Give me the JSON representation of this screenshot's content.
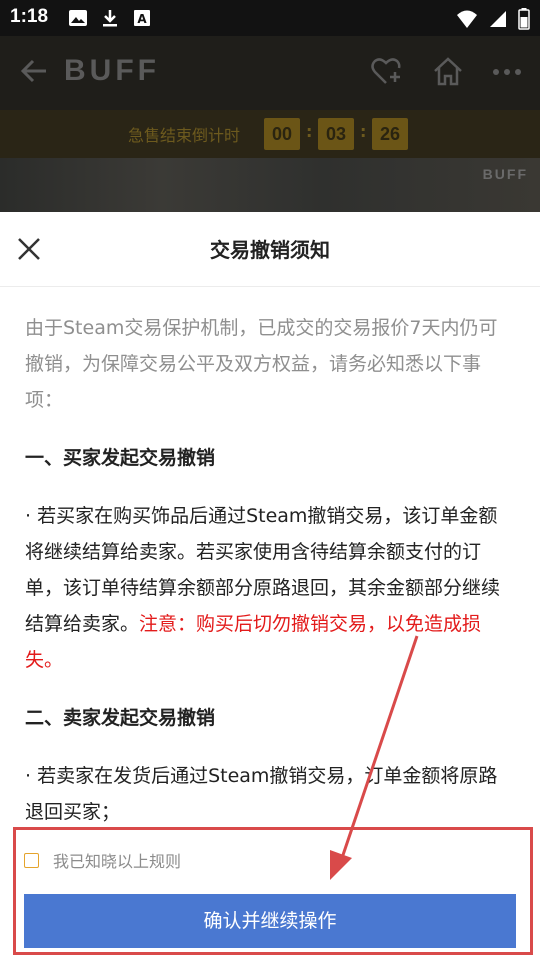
{
  "status_bar": {
    "time": "1:18",
    "left_icons": [
      "image-icon",
      "download-icon",
      "a-icon"
    ],
    "right_icons": [
      "wifi-icon",
      "signal-icon",
      "battery-icon"
    ]
  },
  "header": {
    "logo": "BUFF",
    "icons": [
      "back-arrow-icon",
      "heart-plus-icon",
      "home-icon",
      "more-icon"
    ]
  },
  "countdown": {
    "label": "急售结束倒计时",
    "hours": "00",
    "minutes": "03",
    "seconds": "26"
  },
  "banner": {
    "logo": "BUFF"
  },
  "dialog": {
    "title": "交易撤销须知",
    "intro": "由于Steam交易保护机制，已成交的交易报价7天内仍可撤销，为保障交易公平及双方权益，请务必知悉以下事项：",
    "section1_heading": "一、买家发起交易撤销",
    "section1_text": "· 若买家在购买饰品后通过Steam撤销交易，该订单金额将继续结算给卖家。若买家使用含待结算余额支付的订单，该订单待结算余额部分原路退回，其余金额部分继续结算给卖家。",
    "section1_warning": "注意：购买后切勿撤销交易，以免造成损失。",
    "section2_heading": "二、卖家发起交易撤销",
    "section2_text": "· 若卖家在发货后通过Steam撤销交易，订单金额将原路退回买家；",
    "agree_label": "我已知晓以上规则",
    "confirm_label": "确认并继续操作"
  },
  "colors": {
    "confirm_button": "#4a78d1",
    "warning_text": "#e31b1b",
    "checkbox_border": "#e5a42c",
    "annotation": "#d94a4a"
  }
}
